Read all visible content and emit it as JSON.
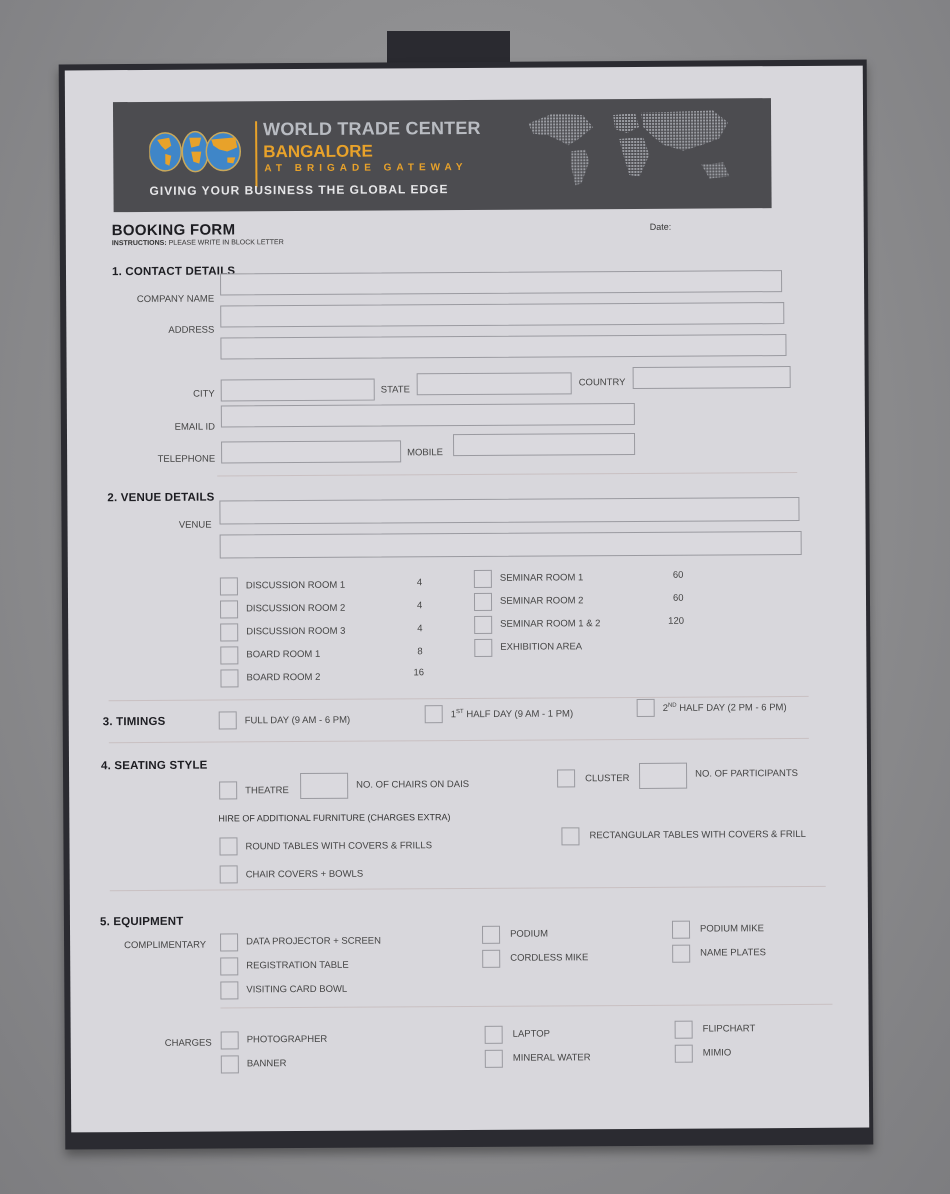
{
  "header": {
    "brand_line1": "WORLD TRADE CENTER",
    "brand_line2": "BANGALORE",
    "brand_line3": "AT BRIGADE GATEWAY",
    "tagline": "GIVING YOUR BUSINESS THE GLOBAL EDGE",
    "colors": {
      "banner": "#4c4c50",
      "accent": "#e8a22a",
      "globe": "#3f86c8"
    }
  },
  "form": {
    "title": "BOOKING FORM",
    "instructions_label": "INSTRUCTIONS:",
    "instructions_text": "PLEASE WRITE IN BLOCK LETTER",
    "date_label": "Date:"
  },
  "contact": {
    "title": "1.  CONTACT DETAILS",
    "company_name": "COMPANY NAME",
    "address": "ADDRESS",
    "city": "CITY",
    "state": "STATE",
    "country": "COUNTRY",
    "email": "EMAIL ID",
    "telephone": "TELEPHONE",
    "mobile": "MOBILE"
  },
  "venue": {
    "title": "2.  VENUE DETAILS",
    "venue_label": "VENUE",
    "rooms_left": [
      {
        "name": "DISCUSSION ROOM 1",
        "capacity": "4"
      },
      {
        "name": "DISCUSSION ROOM 2",
        "capacity": "4"
      },
      {
        "name": "DISCUSSION ROOM 3",
        "capacity": "4"
      },
      {
        "name": "BOARD ROOM 1",
        "capacity": "8"
      },
      {
        "name": "BOARD ROOM 2",
        "capacity": "16"
      }
    ],
    "rooms_right": [
      {
        "name": "SEMINAR ROOM 1",
        "capacity": "60"
      },
      {
        "name": "SEMINAR ROOM 2",
        "capacity": "60"
      },
      {
        "name": "SEMINAR ROOM 1 & 2",
        "capacity": "120"
      },
      {
        "name": "EXHIBITION AREA",
        "capacity": ""
      }
    ]
  },
  "timings": {
    "title": "3.  TIMINGS",
    "full_day": "FULL DAY (9 AM - 6 PM)",
    "first_half_num": "1",
    "first_half_sup": "ST",
    "first_half_text": " HALF DAY (9 AM - 1 PM)",
    "second_half_num": "2",
    "second_half_sup": "ND",
    "second_half_text": " HALF DAY (2 PM - 6 PM)"
  },
  "seating": {
    "title": "4.  SEATING STYLE",
    "theatre": "THEATRE",
    "chairs_on_dais": "NO. OF CHAIRS ON DAIS",
    "cluster": "CLUSTER",
    "participants": "NO. OF PARTICIPANTS",
    "furniture_heading": "HIRE OF ADDITIONAL FURNITURE (CHARGES EXTRA)",
    "round_tables": "ROUND TABLES WITH COVERS & FRILLS",
    "rect_tables": "RECTANGULAR TABLES WITH COVERS & FRILL",
    "chair_covers": "CHAIR COVERS + BOWLS"
  },
  "equipment": {
    "title": "5.  EQUIPMENT",
    "complimentary_label": "COMPLIMENTARY",
    "complimentary": {
      "col1": [
        "DATA PROJECTOR + SCREEN",
        "REGISTRATION TABLE",
        "VISITING CARD BOWL"
      ],
      "col2": [
        "PODIUM",
        "CORDLESS MIKE"
      ],
      "col3": [
        "PODIUM MIKE",
        "NAME PLATES"
      ]
    },
    "charges_label": "CHARGES",
    "charges": {
      "col1": [
        "PHOTOGRAPHER",
        "BANNER"
      ],
      "col2": [
        "LAPTOP",
        "MINERAL WATER"
      ],
      "col3": [
        "FLIPCHART",
        "MIMIO"
      ]
    }
  }
}
